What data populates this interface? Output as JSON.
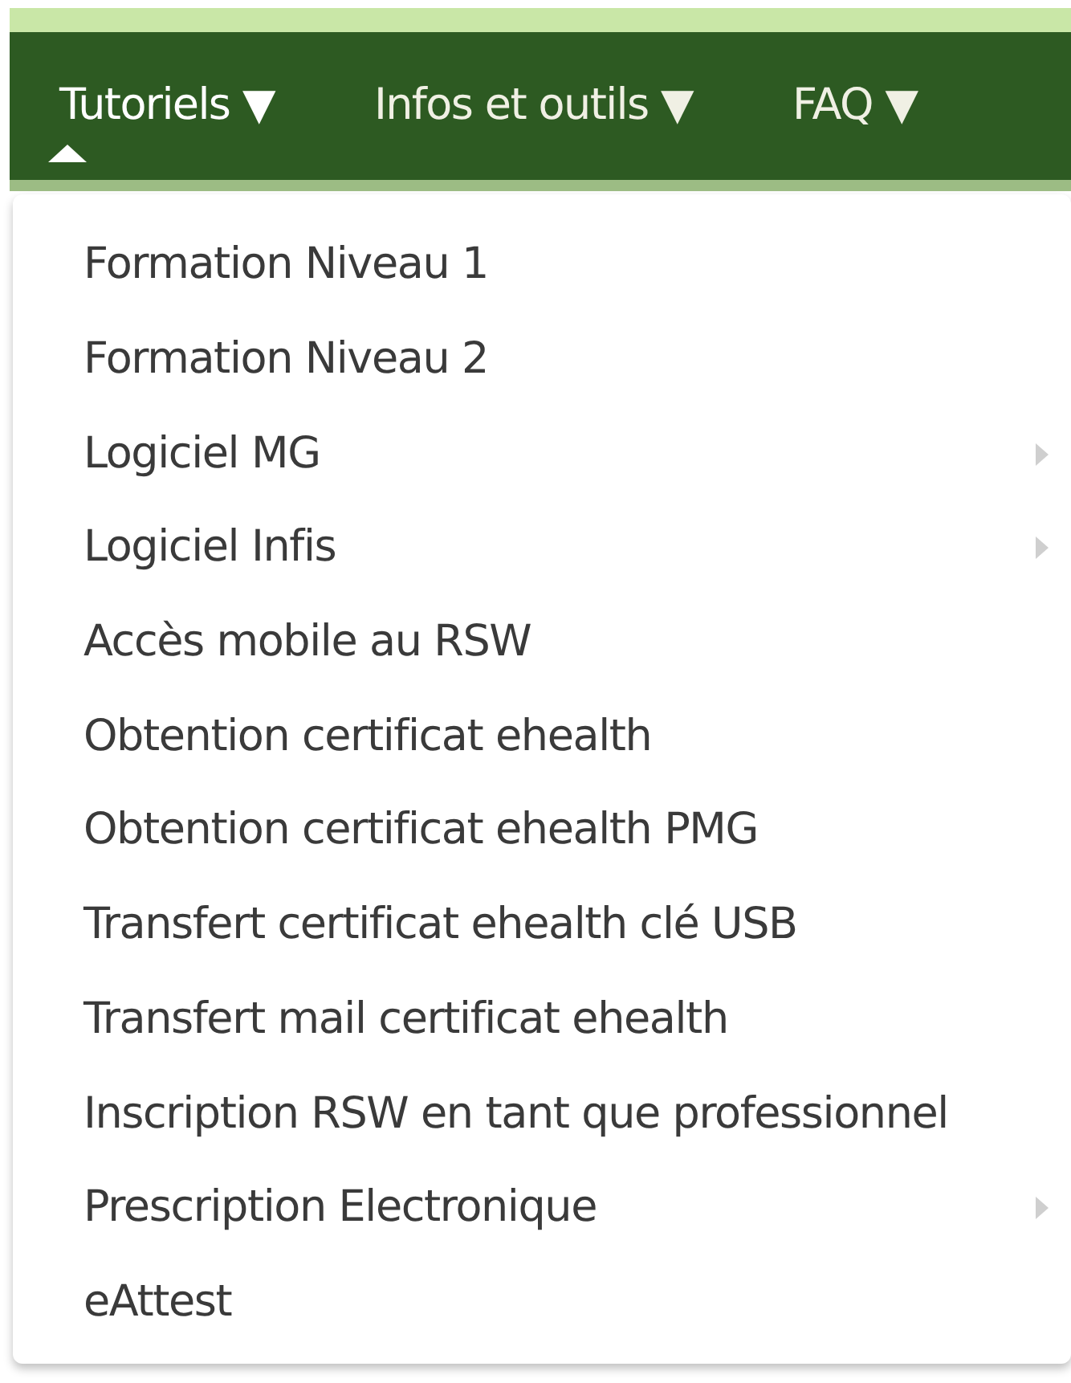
{
  "nav": [
    {
      "label": "Tutoriels ▼",
      "selected": true
    },
    {
      "label": "Infos et outils ▼",
      "selected": false
    },
    {
      "label": "FAQ ▼",
      "selected": false
    }
  ],
  "menu": {
    "items": [
      {
        "label": "Formation Niveau 1",
        "has_submenu": false
      },
      {
        "label": "Formation Niveau 2",
        "has_submenu": false
      },
      {
        "label": "Logiciel MG",
        "has_submenu": true
      },
      {
        "label": "Logiciel Infis",
        "has_submenu": true
      },
      {
        "label": "Accès mobile au RSW",
        "has_submenu": false
      },
      {
        "label": "Obtention certificat ehealth",
        "has_submenu": false
      },
      {
        "label": "Obtention certificat ehealth PMG",
        "has_submenu": false
      },
      {
        "label": "Transfert certificat ehealth clé USB",
        "has_submenu": false
      },
      {
        "label": "Transfert mail certificat ehealth",
        "has_submenu": false
      },
      {
        "label": "Inscription RSW en tant que professionnel",
        "has_submenu": false
      },
      {
        "label": "Prescription Electronique",
        "has_submenu": true
      },
      {
        "label": "eAttest",
        "has_submenu": false
      }
    ]
  }
}
